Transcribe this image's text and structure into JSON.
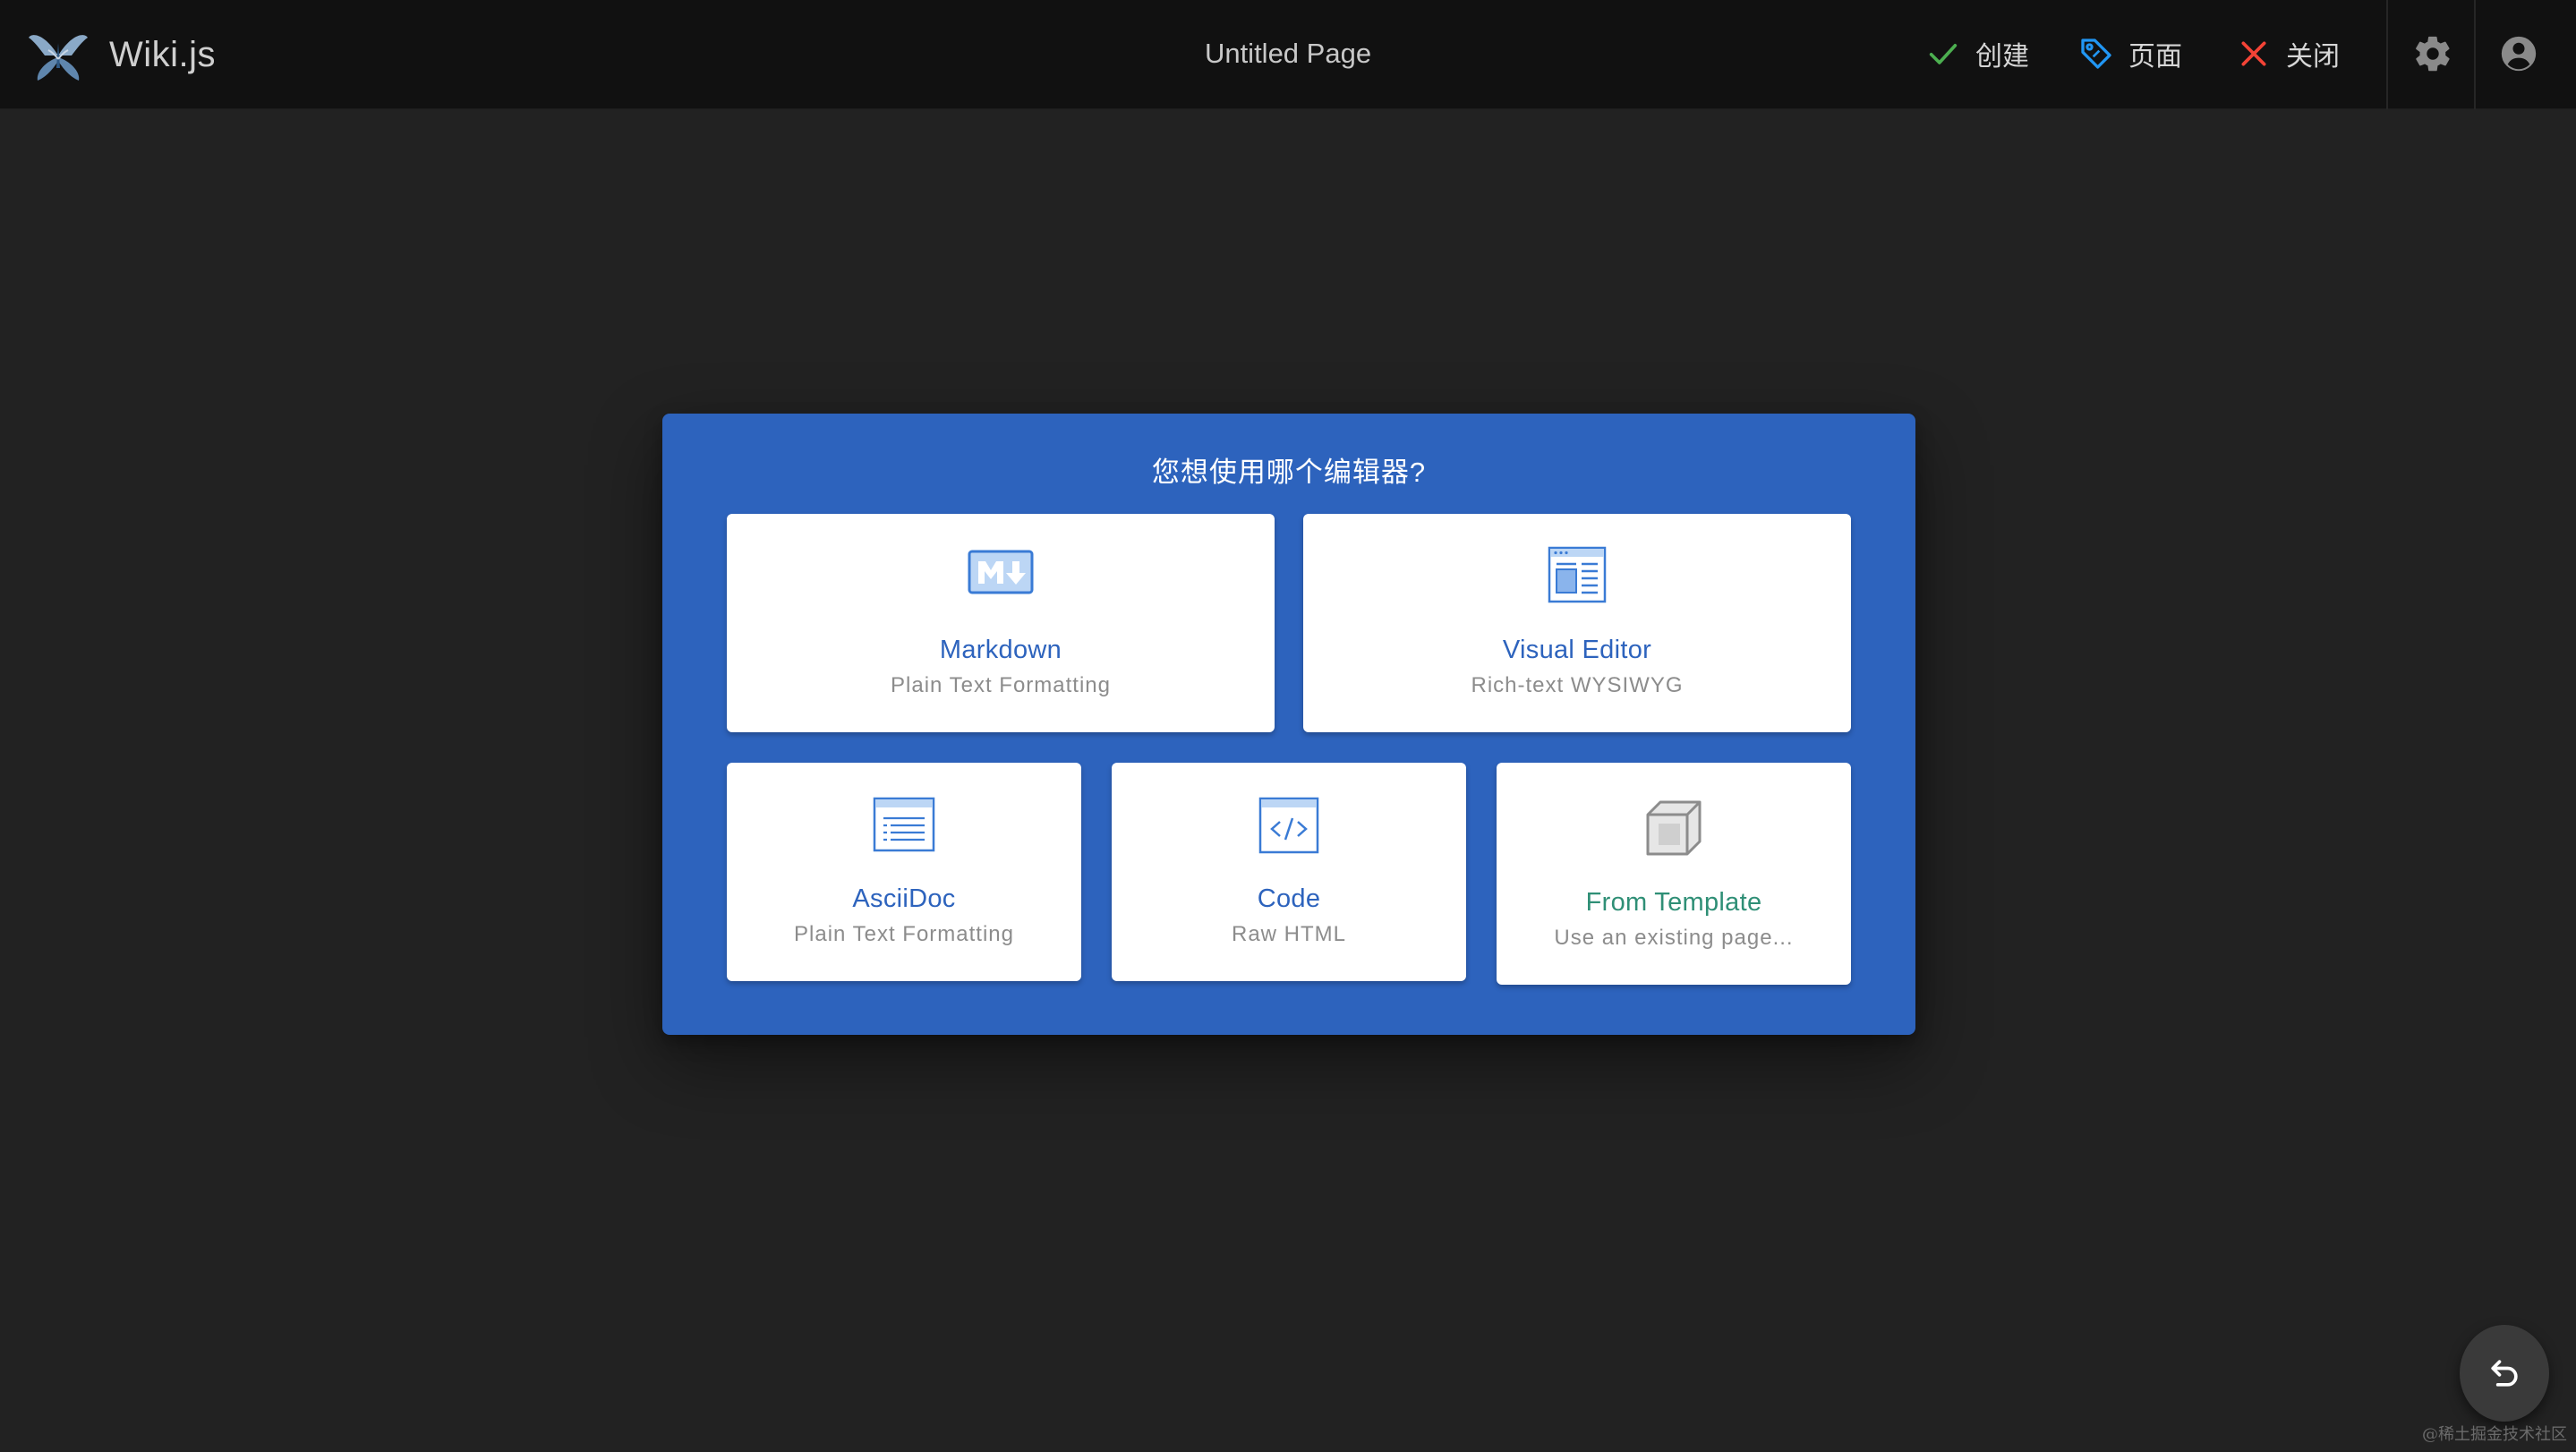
{
  "header": {
    "brand": "Wiki.js",
    "page_title": "Untitled Page",
    "actions": {
      "create": "创建",
      "page": "页面",
      "close": "关闭"
    },
    "icons": {
      "logo": "wikijs-logo-icon",
      "create": "check-icon",
      "page": "tag-icon",
      "close": "close-icon",
      "admin": "gear-icon",
      "account": "account-circle-icon"
    },
    "colors": {
      "create": "#4caf50",
      "page": "#2196f3",
      "close": "#f44336"
    }
  },
  "dialog": {
    "title": "您想使用哪个编辑器?",
    "background": "#2d63bd",
    "editors": [
      {
        "title": "Markdown",
        "subtitle": "Plain Text Formatting",
        "icon": "markdown-icon"
      },
      {
        "title": "Visual Editor",
        "subtitle": "Rich-text WYSIWYG",
        "icon": "visual-editor-icon"
      },
      {
        "title": "AsciiDoc",
        "subtitle": "Plain Text Formatting",
        "icon": "asciidoc-icon"
      },
      {
        "title": "Code",
        "subtitle": "Raw HTML",
        "icon": "code-icon"
      },
      {
        "title": "From Template",
        "subtitle": "Use an existing page...",
        "icon": "cube-icon"
      }
    ]
  },
  "fab": {
    "icon": "undo-icon"
  },
  "watermark": "@稀土掘金技术社区"
}
